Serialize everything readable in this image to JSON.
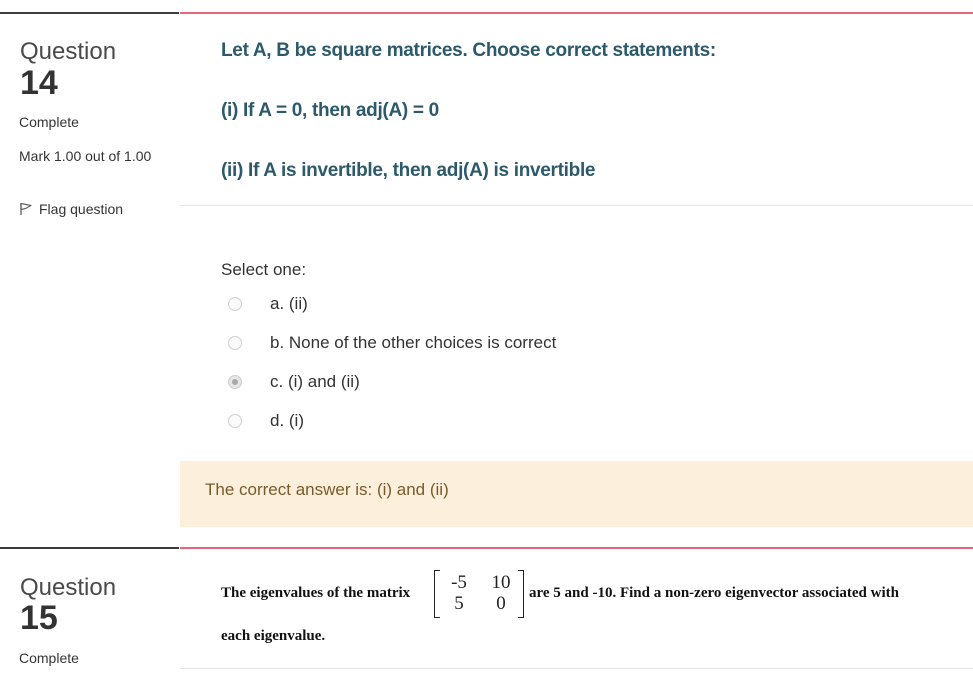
{
  "q14": {
    "label": "Question",
    "number": "14",
    "state": "Complete",
    "mark": "Mark 1.00 out of 1.00",
    "flag": "Flag question",
    "text_lines": [
      "Let A, B be square matrices. Choose correct statements:",
      "(i) If A = 0, then adj(A) = 0",
      "(ii) If A is invertible, then adj(A) is invertible"
    ],
    "select_prompt": "Select one:",
    "options": [
      {
        "label": "a. (ii)",
        "checked": false
      },
      {
        "label": "b. None of the other choices is correct",
        "checked": false
      },
      {
        "label": "c. (i) and (ii)",
        "checked": true
      },
      {
        "label": "d. (i)",
        "checked": false
      }
    ],
    "feedback": "The correct answer is: (i) and (ii)"
  },
  "q15": {
    "label": "Question",
    "number": "15",
    "state": "Complete",
    "text_before": "The eigenvalues of the matrix",
    "matrix": [
      [
        "-5",
        "10"
      ],
      [
        "5",
        "0"
      ]
    ],
    "text_after": "are 5 and -10. Find a non-zero eigenvector associated with",
    "text_line2": "each eigenvalue."
  },
  "colors": {
    "question_text": "#2c5a6a",
    "accent_border": "#e8647a",
    "feedback_bg": "#fcefdc",
    "feedback_text": "#7a5a2a"
  },
  "icons": {
    "flag": "flag-icon"
  }
}
